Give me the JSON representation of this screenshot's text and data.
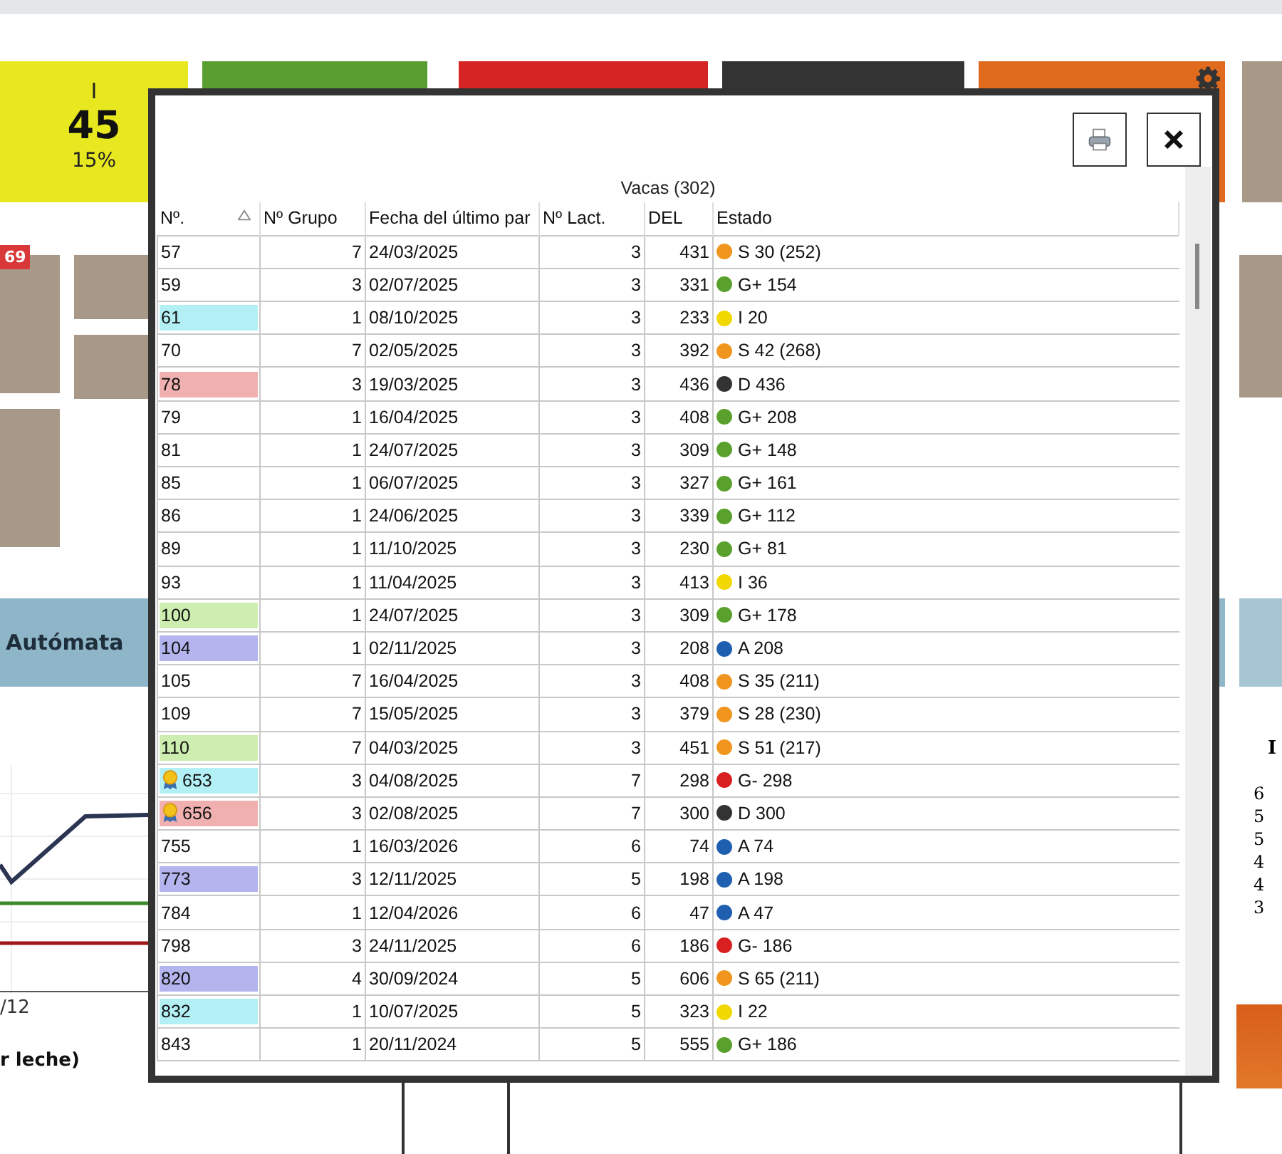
{
  "background": {
    "tiles": [
      {
        "kind": "count",
        "letter": "I",
        "count": "45",
        "percent": "15%",
        "color": "#e8e820"
      },
      {
        "kind": "plain",
        "color": "#5a9e32"
      },
      {
        "kind": "plain",
        "color": "#d42424"
      },
      {
        "kind": "plain",
        "color": "#333333"
      },
      {
        "kind": "settings",
        "color": "#e06a1e"
      }
    ],
    "badge": "69",
    "section_title": "Autómata",
    "axis_label": "/12",
    "chart_caption": "r leche)",
    "right_title": "I",
    "right_values": [
      "6",
      "5",
      "5",
      "4",
      "4",
      "3"
    ]
  },
  "dialog": {
    "title": "Vacas (302)",
    "columns": [
      {
        "label": "Nº.",
        "sorted": true
      },
      {
        "label": "Nº Grupo",
        "sorted": false
      },
      {
        "label": "Fecha del último par",
        "sorted": false
      },
      {
        "label": "Nº Lact.",
        "sorted": false
      },
      {
        "label": "DEL",
        "sorted": false
      },
      {
        "label": "Estado",
        "sorted": false
      }
    ],
    "rows": [
      {
        "number": "57",
        "award": false,
        "group": "7",
        "date": "24/03/2025",
        "lactation": "3",
        "del": "431",
        "color": "#f0961e",
        "status": "S 30 (252)"
      },
      {
        "number": "59",
        "award": false,
        "group": "3",
        "date": "02/07/2025",
        "lactation": "3",
        "del": "331",
        "color": "#5aa02c",
        "status": "G+ 154"
      },
      {
        "number": "61",
        "tag": {
          "color": "#b3f0f5"
        },
        "award": false,
        "group": "1",
        "date": "08/10/2025",
        "lactation": "3",
        "del": "233",
        "color": "#f0d800",
        "status": "I 20"
      },
      {
        "number": "70",
        "award": false,
        "group": "7",
        "date": "02/05/2025",
        "lactation": "3",
        "del": "392",
        "color": "#f0961e",
        "status": "S 42 (268)"
      },
      {
        "number": "78",
        "tag": {
          "color": "#f0b0b0"
        },
        "award": false,
        "group": "3",
        "date": "19/03/2025",
        "lactation": "3",
        "del": "436",
        "color": "#333333",
        "status": "D 436"
      },
      {
        "number": "79",
        "award": false,
        "group": "1",
        "date": "16/04/2025",
        "lactation": "3",
        "del": "408",
        "color": "#5aa02c",
        "status": "G+ 208"
      },
      {
        "number": "81",
        "award": false,
        "group": "1",
        "date": "24/07/2025",
        "lactation": "3",
        "del": "309",
        "color": "#5aa02c",
        "status": "G+ 148"
      },
      {
        "number": "85",
        "award": false,
        "group": "1",
        "date": "06/07/2025",
        "lactation": "3",
        "del": "327",
        "color": "#5aa02c",
        "status": "G+ 161"
      },
      {
        "number": "86",
        "award": false,
        "group": "1",
        "date": "24/06/2025",
        "lactation": "3",
        "del": "339",
        "color": "#5aa02c",
        "status": "G+ 112"
      },
      {
        "number": "89",
        "award": false,
        "group": "1",
        "date": "11/10/2025",
        "lactation": "3",
        "del": "230",
        "color": "#5aa02c",
        "status": "G+ 81"
      },
      {
        "number": "93",
        "award": false,
        "group": "1",
        "date": "11/04/2025",
        "lactation": "3",
        "del": "413",
        "color": "#f0d800",
        "status": "I 36"
      },
      {
        "number": "100",
        "tag": {
          "color": "#cdeeb0"
        },
        "award": false,
        "group": "1",
        "date": "24/07/2025",
        "lactation": "3",
        "del": "309",
        "color": "#5aa02c",
        "status": "G+ 178"
      },
      {
        "number": "104",
        "tag": {
          "color": "#b4b4ee"
        },
        "award": false,
        "group": "1",
        "date": "02/11/2025",
        "lactation": "3",
        "del": "208",
        "color": "#1f5fb0",
        "status": "A 208"
      },
      {
        "number": "105",
        "award": false,
        "group": "7",
        "date": "16/04/2025",
        "lactation": "3",
        "del": "408",
        "color": "#f0961e",
        "status": "S 35 (211)"
      },
      {
        "number": "109",
        "award": false,
        "group": "7",
        "date": "15/05/2025",
        "lactation": "3",
        "del": "379",
        "color": "#f0961e",
        "status": "S 28 (230)"
      },
      {
        "number": "110",
        "tag": {
          "color": "#cdeeb0"
        },
        "award": false,
        "group": "7",
        "date": "04/03/2025",
        "lactation": "3",
        "del": "451",
        "color": "#f0961e",
        "status": "S 51 (217)"
      },
      {
        "number": "653",
        "tag": {
          "color": "#b3f0f5"
        },
        "award": true,
        "group": "3",
        "date": "04/08/2025",
        "lactation": "7",
        "del": "298",
        "color": "#d82020",
        "status": "G- 298"
      },
      {
        "number": "656",
        "tag": {
          "color": "#f0b0b0"
        },
        "award": true,
        "group": "3",
        "date": "02/08/2025",
        "lactation": "7",
        "del": "300",
        "color": "#333333",
        "status": "D 300"
      },
      {
        "number": "755",
        "award": false,
        "group": "1",
        "date": "16/03/2026",
        "lactation": "6",
        "del": "74",
        "color": "#1f5fb0",
        "status": "A 74"
      },
      {
        "number": "773",
        "tag": {
          "color": "#b4b4ee"
        },
        "award": false,
        "group": "3",
        "date": "12/11/2025",
        "lactation": "5",
        "del": "198",
        "color": "#1f5fb0",
        "status": "A 198"
      },
      {
        "number": "784",
        "award": false,
        "group": "1",
        "date": "12/04/2026",
        "lactation": "6",
        "del": "47",
        "color": "#1f5fb0",
        "status": "A 47"
      },
      {
        "number": "798",
        "award": false,
        "group": "3",
        "date": "24/11/2025",
        "lactation": "6",
        "del": "186",
        "color": "#d82020",
        "status": "G- 186"
      },
      {
        "number": "820",
        "tag": {
          "color": "#b4b4ee"
        },
        "award": false,
        "group": "4",
        "date": "30/09/2024",
        "lactation": "5",
        "del": "606",
        "color": "#f0961e",
        "status": "S 65 (211)"
      },
      {
        "number": "832",
        "tag": {
          "color": "#b3f0f5"
        },
        "award": false,
        "group": "1",
        "date": "10/07/2025",
        "lactation": "5",
        "del": "323",
        "color": "#f0d800",
        "status": "I 22"
      },
      {
        "number": "843",
        "award": false,
        "group": "1",
        "date": "20/11/2024",
        "lactation": "5",
        "del": "555",
        "color": "#5aa02c",
        "status": "G+ 186"
      }
    ]
  }
}
